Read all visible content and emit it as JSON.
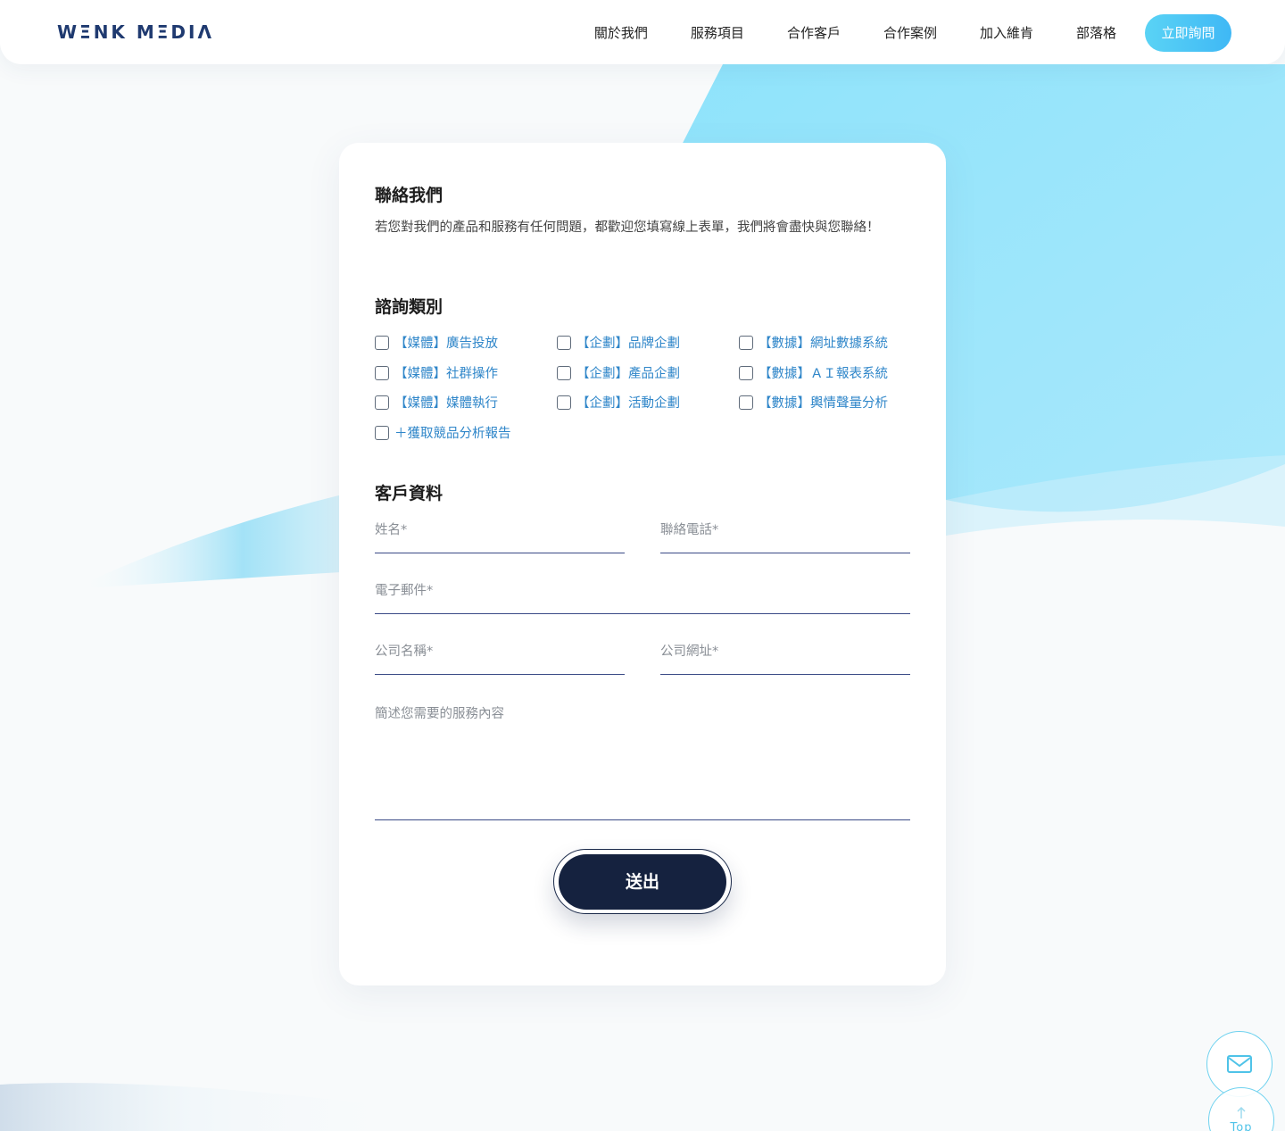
{
  "header": {
    "logo": "WΞNK MΞDIΛ",
    "nav": [
      "關於我們",
      "服務項目",
      "合作客戶",
      "合作案例",
      "加入維肯",
      "部落格"
    ],
    "cta": "立即詢問"
  },
  "contact": {
    "title": "聯絡我們",
    "intro": "若您對我們的產品和服務有任何問題，都歡迎您填寫線上表單，我們將會盡快與您聯絡！"
  },
  "category": {
    "title": "諮詢類別",
    "options": [
      "【媒體】廣告投放",
      "【企劃】品牌企劃",
      "【數據】網址數據系統",
      "【媒體】社群操作",
      "【企劃】產品企劃",
      "【數據】ＡＩ報表系統",
      "【媒體】媒體執行",
      "【企劃】活動企劃",
      "【數據】輿情聲量分析",
      "＋獲取競品分析報告"
    ]
  },
  "client": {
    "title": "客戶資料",
    "name_placeholder": "姓名*",
    "phone_placeholder": "聯絡電話*",
    "email_placeholder": "電子郵件*",
    "company_placeholder": "公司名稱*",
    "website_placeholder": "公司網址*",
    "message_placeholder": "簡述您需要的服務內容"
  },
  "submit_label": "送出",
  "float": {
    "top_label": "Top"
  },
  "colors": {
    "accent": "#4fc3e8",
    "navy": "#15223f",
    "link": "#2f86c9"
  }
}
